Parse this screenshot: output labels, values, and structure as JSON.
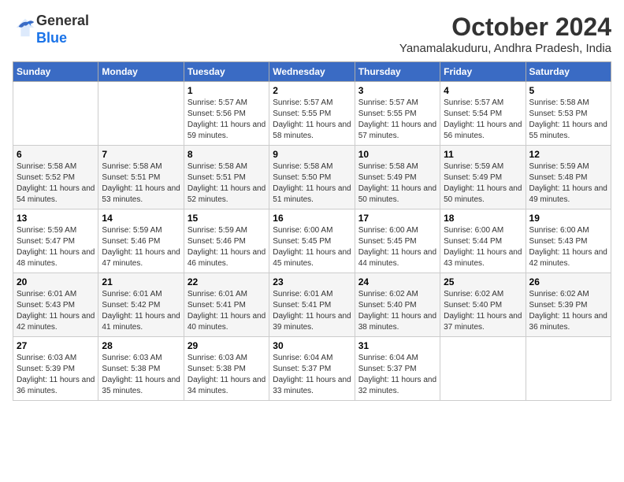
{
  "logo": {
    "general": "General",
    "blue": "Blue"
  },
  "title": "October 2024",
  "subtitle": "Yanamalakuduru, Andhra Pradesh, India",
  "days_header": [
    "Sunday",
    "Monday",
    "Tuesday",
    "Wednesday",
    "Thursday",
    "Friday",
    "Saturday"
  ],
  "weeks": [
    [
      {
        "day": "",
        "info": ""
      },
      {
        "day": "",
        "info": ""
      },
      {
        "day": "1",
        "info": "Sunrise: 5:57 AM\nSunset: 5:56 PM\nDaylight: 11 hours and 59 minutes."
      },
      {
        "day": "2",
        "info": "Sunrise: 5:57 AM\nSunset: 5:55 PM\nDaylight: 11 hours and 58 minutes."
      },
      {
        "day": "3",
        "info": "Sunrise: 5:57 AM\nSunset: 5:55 PM\nDaylight: 11 hours and 57 minutes."
      },
      {
        "day": "4",
        "info": "Sunrise: 5:57 AM\nSunset: 5:54 PM\nDaylight: 11 hours and 56 minutes."
      },
      {
        "day": "5",
        "info": "Sunrise: 5:58 AM\nSunset: 5:53 PM\nDaylight: 11 hours and 55 minutes."
      }
    ],
    [
      {
        "day": "6",
        "info": "Sunrise: 5:58 AM\nSunset: 5:52 PM\nDaylight: 11 hours and 54 minutes."
      },
      {
        "day": "7",
        "info": "Sunrise: 5:58 AM\nSunset: 5:51 PM\nDaylight: 11 hours and 53 minutes."
      },
      {
        "day": "8",
        "info": "Sunrise: 5:58 AM\nSunset: 5:51 PM\nDaylight: 11 hours and 52 minutes."
      },
      {
        "day": "9",
        "info": "Sunrise: 5:58 AM\nSunset: 5:50 PM\nDaylight: 11 hours and 51 minutes."
      },
      {
        "day": "10",
        "info": "Sunrise: 5:58 AM\nSunset: 5:49 PM\nDaylight: 11 hours and 50 minutes."
      },
      {
        "day": "11",
        "info": "Sunrise: 5:59 AM\nSunset: 5:49 PM\nDaylight: 11 hours and 50 minutes."
      },
      {
        "day": "12",
        "info": "Sunrise: 5:59 AM\nSunset: 5:48 PM\nDaylight: 11 hours and 49 minutes."
      }
    ],
    [
      {
        "day": "13",
        "info": "Sunrise: 5:59 AM\nSunset: 5:47 PM\nDaylight: 11 hours and 48 minutes."
      },
      {
        "day": "14",
        "info": "Sunrise: 5:59 AM\nSunset: 5:46 PM\nDaylight: 11 hours and 47 minutes."
      },
      {
        "day": "15",
        "info": "Sunrise: 5:59 AM\nSunset: 5:46 PM\nDaylight: 11 hours and 46 minutes."
      },
      {
        "day": "16",
        "info": "Sunrise: 6:00 AM\nSunset: 5:45 PM\nDaylight: 11 hours and 45 minutes."
      },
      {
        "day": "17",
        "info": "Sunrise: 6:00 AM\nSunset: 5:45 PM\nDaylight: 11 hours and 44 minutes."
      },
      {
        "day": "18",
        "info": "Sunrise: 6:00 AM\nSunset: 5:44 PM\nDaylight: 11 hours and 43 minutes."
      },
      {
        "day": "19",
        "info": "Sunrise: 6:00 AM\nSunset: 5:43 PM\nDaylight: 11 hours and 42 minutes."
      }
    ],
    [
      {
        "day": "20",
        "info": "Sunrise: 6:01 AM\nSunset: 5:43 PM\nDaylight: 11 hours and 42 minutes."
      },
      {
        "day": "21",
        "info": "Sunrise: 6:01 AM\nSunset: 5:42 PM\nDaylight: 11 hours and 41 minutes."
      },
      {
        "day": "22",
        "info": "Sunrise: 6:01 AM\nSunset: 5:41 PM\nDaylight: 11 hours and 40 minutes."
      },
      {
        "day": "23",
        "info": "Sunrise: 6:01 AM\nSunset: 5:41 PM\nDaylight: 11 hours and 39 minutes."
      },
      {
        "day": "24",
        "info": "Sunrise: 6:02 AM\nSunset: 5:40 PM\nDaylight: 11 hours and 38 minutes."
      },
      {
        "day": "25",
        "info": "Sunrise: 6:02 AM\nSunset: 5:40 PM\nDaylight: 11 hours and 37 minutes."
      },
      {
        "day": "26",
        "info": "Sunrise: 6:02 AM\nSunset: 5:39 PM\nDaylight: 11 hours and 36 minutes."
      }
    ],
    [
      {
        "day": "27",
        "info": "Sunrise: 6:03 AM\nSunset: 5:39 PM\nDaylight: 11 hours and 36 minutes."
      },
      {
        "day": "28",
        "info": "Sunrise: 6:03 AM\nSunset: 5:38 PM\nDaylight: 11 hours and 35 minutes."
      },
      {
        "day": "29",
        "info": "Sunrise: 6:03 AM\nSunset: 5:38 PM\nDaylight: 11 hours and 34 minutes."
      },
      {
        "day": "30",
        "info": "Sunrise: 6:04 AM\nSunset: 5:37 PM\nDaylight: 11 hours and 33 minutes."
      },
      {
        "day": "31",
        "info": "Sunrise: 6:04 AM\nSunset: 5:37 PM\nDaylight: 11 hours and 32 minutes."
      },
      {
        "day": "",
        "info": ""
      },
      {
        "day": "",
        "info": ""
      }
    ]
  ]
}
